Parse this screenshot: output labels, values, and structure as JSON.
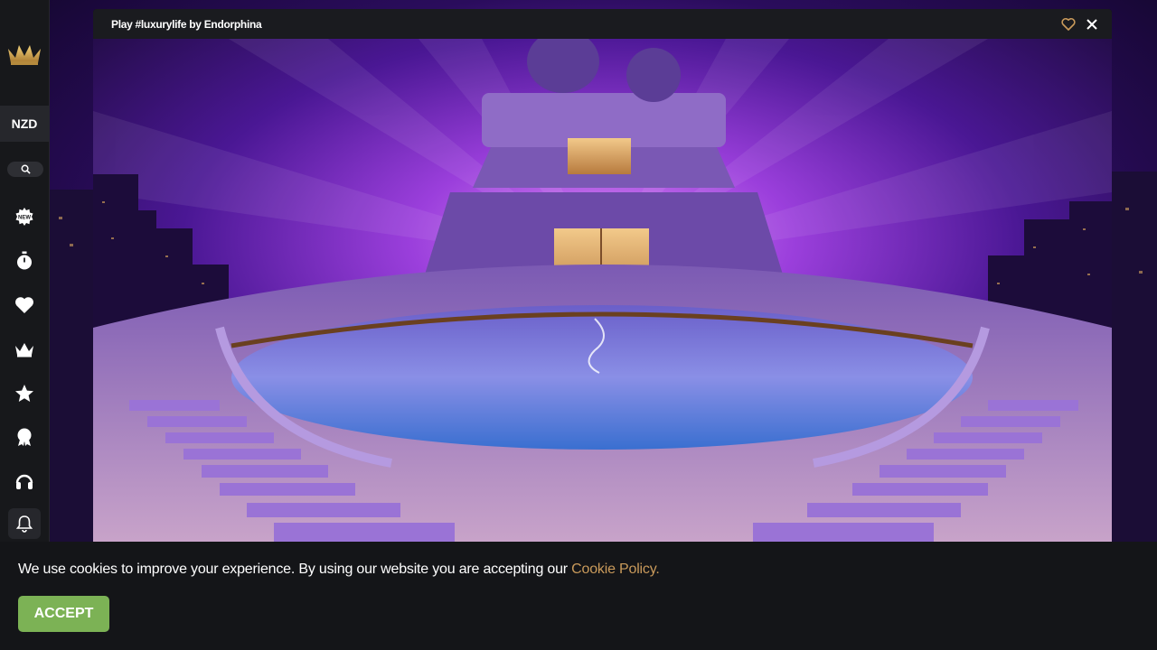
{
  "sidebar": {
    "currency": "NZD",
    "icons": [
      "crown-logo-icon",
      "search-icon",
      "new-badge-icon",
      "stopwatch-icon",
      "heart-icon",
      "crown-icon",
      "star-icon",
      "trophy-icon",
      "headset-icon",
      "bell-icon"
    ]
  },
  "game": {
    "title": "Play #luxurylife by Endorphina",
    "provider": "Endorphina"
  },
  "cookie": {
    "message": "We use cookies to improve your experience. By using our website you are accepting our ",
    "link_label": "Cookie Policy.",
    "accept_label": "ACCEPT"
  },
  "colors": {
    "accent_gold": "#c99a5b",
    "accept_green": "#7cb255",
    "sidebar_bg": "#17181b"
  }
}
